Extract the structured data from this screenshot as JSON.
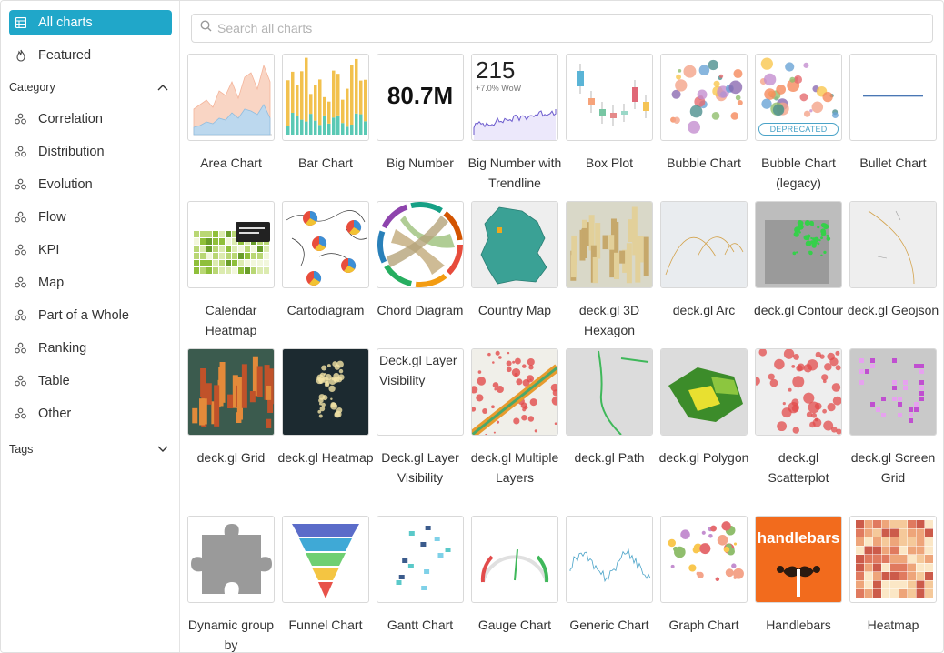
{
  "sidebar": {
    "all_charts": "All charts",
    "featured": "Featured",
    "category_heading": "Category",
    "categories": [
      "Correlation",
      "Distribution",
      "Evolution",
      "Flow",
      "KPI",
      "Map",
      "Part of a Whole",
      "Ranking",
      "Table",
      "Other"
    ],
    "tags_heading": "Tags"
  },
  "search": {
    "placeholder": "Search all charts"
  },
  "colors": {
    "accent": "#20a7c9"
  },
  "charts": [
    {
      "label": "Area Chart",
      "thumb": "area"
    },
    {
      "label": "Bar Chart",
      "thumb": "bar"
    },
    {
      "label": "Big Number",
      "thumb": "bignumber",
      "value": "80.7M"
    },
    {
      "label": "Big Number with Trendline",
      "thumb": "trendline",
      "value": "215",
      "delta": "+7.0% WoW"
    },
    {
      "label": "Box Plot",
      "thumb": "box"
    },
    {
      "label": "Bubble Chart",
      "thumb": "bubble"
    },
    {
      "label": "Bubble Chart (legacy)",
      "thumb": "bubble_legacy",
      "badge": "DEPRECATED"
    },
    {
      "label": "Bullet Chart",
      "thumb": "bullet"
    },
    {
      "label": "Calendar Heatmap",
      "thumb": "calendar"
    },
    {
      "label": "Cartodiagram",
      "thumb": "carto"
    },
    {
      "label": "Chord Diagram",
      "thumb": "chord"
    },
    {
      "label": "Country Map",
      "thumb": "country"
    },
    {
      "label": "deck.gl 3D Hexagon",
      "thumb": "hexagon"
    },
    {
      "label": "deck.gl Arc",
      "thumb": "arc"
    },
    {
      "label": "deck.gl Contour",
      "thumb": "contour"
    },
    {
      "label": "deck.gl Geojson",
      "thumb": "geojson"
    },
    {
      "label": "deck.gl Grid",
      "thumb": "grid3d"
    },
    {
      "label": "deck.gl Heatmap",
      "thumb": "heatmap_dark"
    },
    {
      "label": "Deck.gl Layer Visibility",
      "thumb": "broken",
      "alt": "Deck.gl Layer Visibility"
    },
    {
      "label": "deck.gl Multiple Layers",
      "thumb": "multilayers"
    },
    {
      "label": "deck.gl Path",
      "thumb": "path"
    },
    {
      "label": "deck.gl Polygon",
      "thumb": "polygon"
    },
    {
      "label": "deck.gl Scatterplot",
      "thumb": "scatterplot"
    },
    {
      "label": "deck.gl Screen Grid",
      "thumb": "screengrid"
    },
    {
      "label": "Dynamic group by",
      "thumb": "puzzle"
    },
    {
      "label": "Funnel Chart",
      "thumb": "funnel"
    },
    {
      "label": "Gantt Chart",
      "thumb": "gantt"
    },
    {
      "label": "Gauge Chart",
      "thumb": "gauge"
    },
    {
      "label": "Generic Chart",
      "thumb": "generic"
    },
    {
      "label": "Graph Chart",
      "thumb": "graph"
    },
    {
      "label": "Handlebars",
      "thumb": "handlebars",
      "value": "handlebars"
    },
    {
      "label": "Heatmap",
      "thumb": "heatmap"
    }
  ]
}
